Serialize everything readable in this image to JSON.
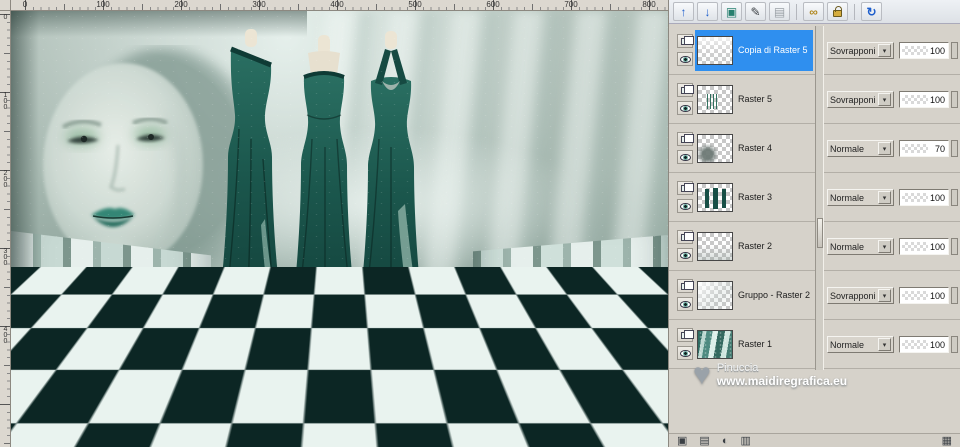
{
  "canvas": {
    "rulers": {
      "h": [
        "0",
        "100",
        "200",
        "300",
        "400",
        "500",
        "600",
        "700",
        "800"
      ],
      "v": [
        "0",
        "100",
        "200",
        "300",
        "400"
      ]
    }
  },
  "layers_panel": {
    "toolbar_icons": [
      {
        "name": "arrow-up-icon",
        "glyph": "↑"
      },
      {
        "name": "arrow-down-icon",
        "glyph": "↓"
      },
      {
        "name": "new-layer-icon",
        "glyph": "▣"
      },
      {
        "name": "edit-layer-icon",
        "glyph": "✎"
      },
      {
        "name": "delete-layer-icon",
        "glyph": "▤"
      },
      {
        "name": "link-layers-icon",
        "glyph": "∞"
      },
      {
        "name": "lock-transparency-icon",
        "glyph": ""
      },
      {
        "name": "reset-icon",
        "glyph": "↻"
      }
    ],
    "layers": [
      {
        "name": "Copia di Raster 5",
        "blend": "Sovrapponi",
        "opacity": "100",
        "selected": true
      },
      {
        "name": "Raster 5",
        "blend": "Sovrapponi",
        "opacity": "100",
        "selected": false
      },
      {
        "name": "Raster 4",
        "blend": "Normale",
        "opacity": "70",
        "selected": false
      },
      {
        "name": "Raster 3",
        "blend": "Normale",
        "opacity": "100",
        "selected": false
      },
      {
        "name": "Raster 2",
        "blend": "Normale",
        "opacity": "100",
        "selected": false
      },
      {
        "name": "Gruppo - Raster 2",
        "blend": "Sovrapponi",
        "opacity": "100",
        "selected": false
      },
      {
        "name": "Raster 1",
        "blend": "Normale",
        "opacity": "100",
        "selected": false
      }
    ],
    "bottom_icons": [
      {
        "name": "bottom-toolbar-icon-1",
        "glyph": "▣"
      },
      {
        "name": "bottom-toolbar-icon-2",
        "glyph": "▤"
      },
      {
        "name": "bottom-toolbar-icon-3",
        "glyph": "◐"
      },
      {
        "name": "bottom-toolbar-icon-4",
        "glyph": "▥"
      },
      {
        "name": "bottom-toolbar-icon-5",
        "glyph": "▦"
      }
    ],
    "watermark": {
      "line1": "Pinuccia",
      "line2": "www.maidiregrafica.eu"
    }
  },
  "colors": {
    "selection_blue": "#2f8fef",
    "dress_teal": "#1b574d",
    "floor_dark": "#0c2624",
    "floor_light": "#e9f3ef",
    "lips_teal": "#2f8472"
  }
}
